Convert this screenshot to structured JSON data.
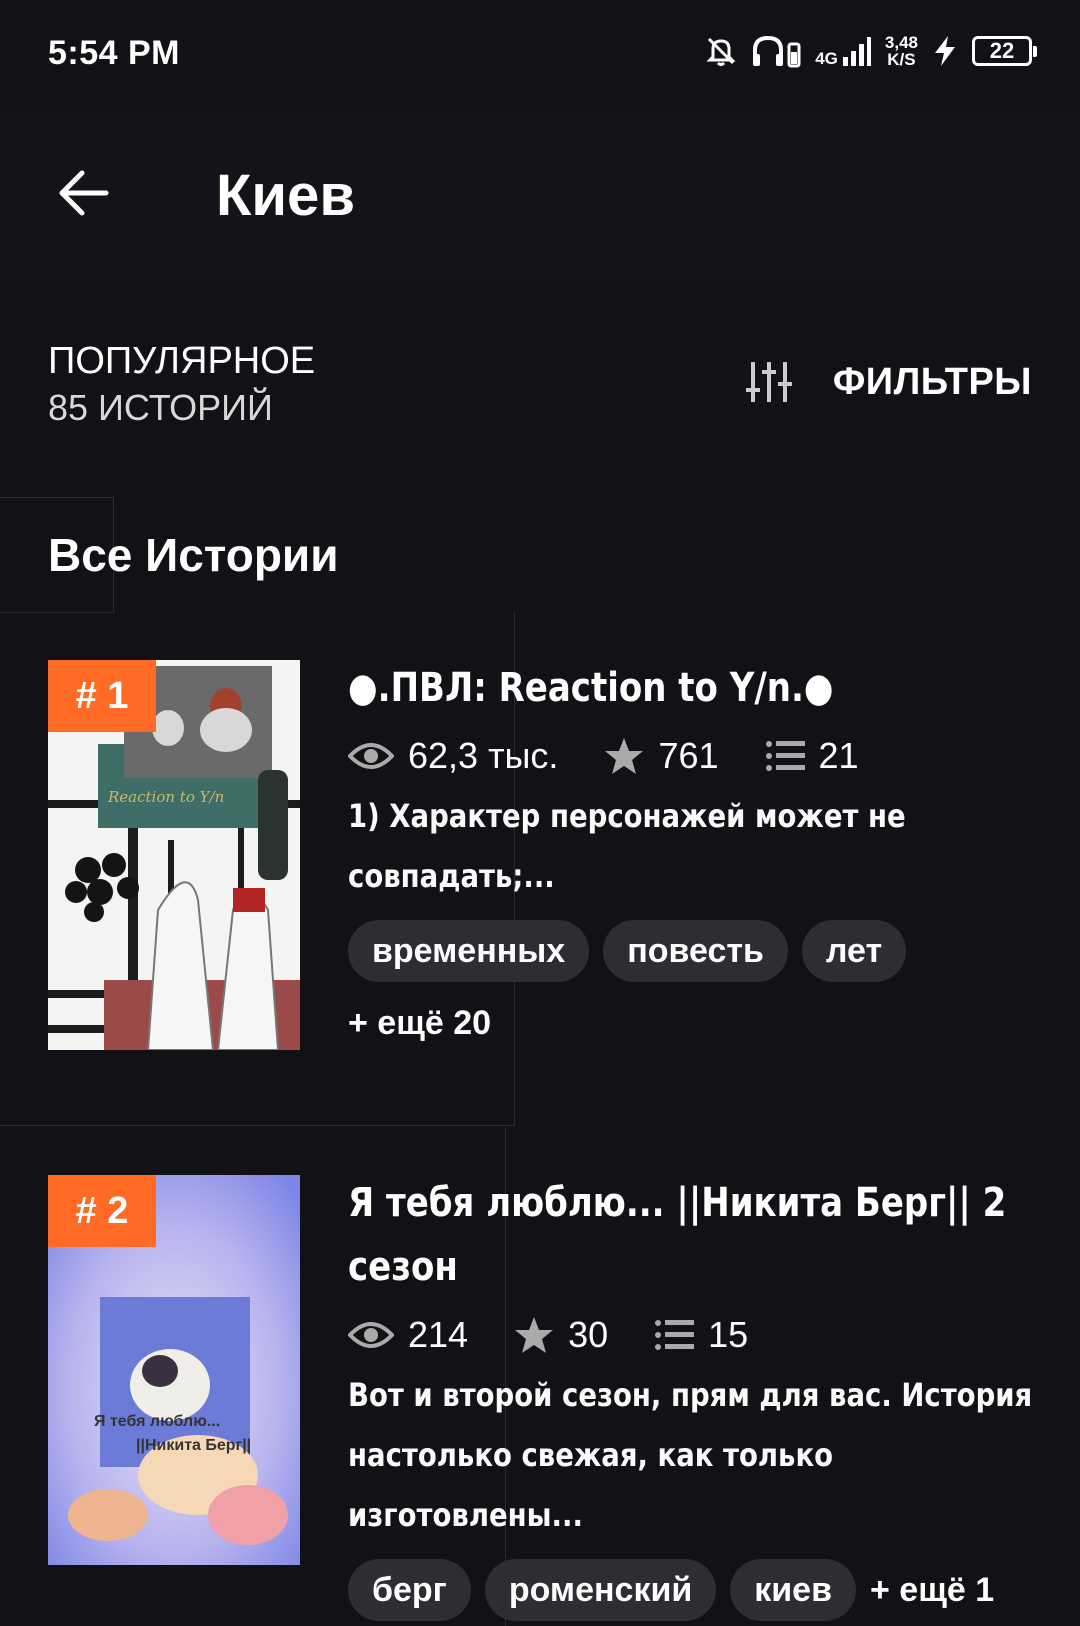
{
  "status_bar": {
    "time": "5:54 PM",
    "net_speed": "3,48",
    "net_unit": "K/S",
    "network": "4G",
    "battery": "22"
  },
  "header": {
    "title": "Киев",
    "back_icon": "arrow-left-icon"
  },
  "section": {
    "title": "ПОПУЛЯРНОЕ",
    "count": "85 ИСТОРИЙ",
    "filters_label": "ФИЛЬТРЫ"
  },
  "list_title": "Все Истории",
  "stories": [
    {
      "rank": "# 1",
      "cover_text": "Reaction to Y/n",
      "title": "●.ПВЛ: Reaction to Y/n.●",
      "views": "62,3 тыс.",
      "votes": "761",
      "parts": "21",
      "description": "1) Характер персонажей может не совпадать;...",
      "tags": [
        "временных",
        "повесть",
        "лет"
      ],
      "more": "+ ещё 20"
    },
    {
      "rank": "# 2",
      "cover_text_1": "Я тебя люблю...",
      "cover_text_2": "||Никита Берг||",
      "title": "Я тебя люблю... ||Никита Берг|| 2 сезон",
      "views": "214",
      "votes": "30",
      "parts": "15",
      "description": "Вот и второй сезон, прям для вас. История настолько свежая, как только изготовлены...",
      "tags": [
        "берг",
        "роменский",
        "киев"
      ],
      "more": "+ ещё 1"
    }
  ],
  "colors": {
    "background": "#121115",
    "rank_badge": "#ff6a24",
    "tag_bg": "#2e2d33"
  }
}
